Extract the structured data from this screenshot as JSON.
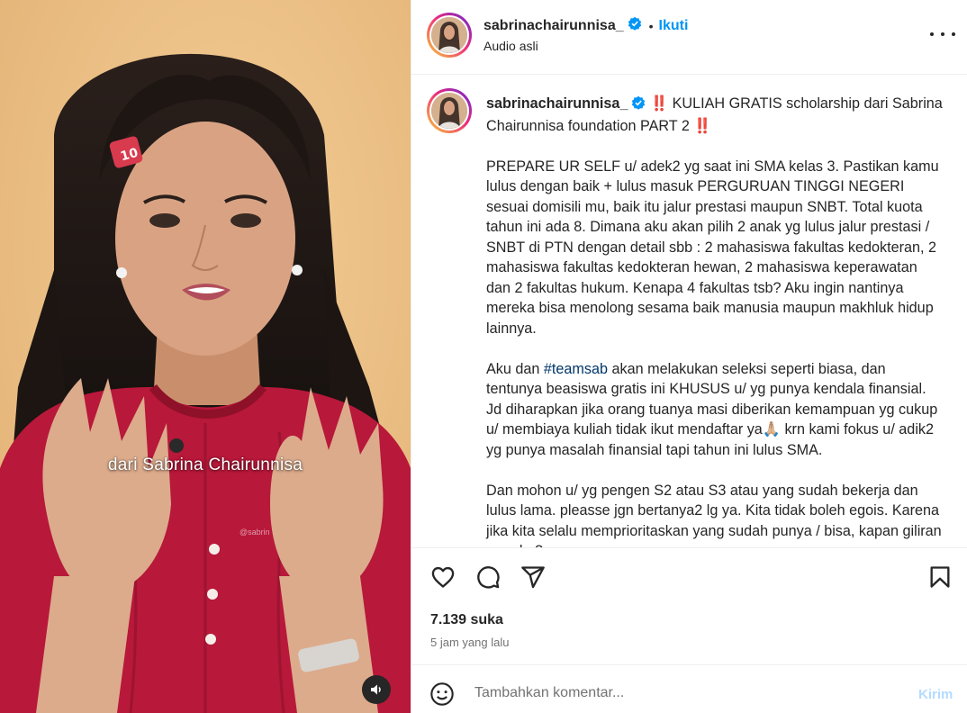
{
  "post": {
    "author": "sabrinachairunnisa_",
    "follow_label": "Ikuti",
    "separator": "•",
    "audio": "Audio asli"
  },
  "video": {
    "subtitle": "dari Sabrina Chairunnisa",
    "watermark": "@sabrin",
    "muted": true
  },
  "caption": {
    "author": "sabrinachairunnisa_",
    "bang_open": "‼️",
    "headline": "KULIAH GRATIS scholarship dari Sabrina Chairunnisa foundation PART 2",
    "bang_close": "‼️",
    "paragraph1": "PREPARE UR SELF u/ adek2 yg saat ini SMA kelas 3. Pastikan kamu lulus dengan baik + lulus masuk PERGURUAN TINGGI NEGERI sesuai domisili mu, baik itu jalur prestasi maupun SNBT. Total kuota tahun ini ada 8. Dimana aku akan pilih 2 anak yg lulus jalur prestasi / SNBT di PTN dengan detail sbb : 2 mahasiswa fakultas kedokteran, 2 mahasiswa fakultas kedokteran hewan, 2 mahasiswa keperawatan dan 2 fakultas hukum. Kenapa 4 fakultas tsb? Aku ingin nantinya mereka bisa menolong sesama baik manusia maupun makhluk hidup lainnya.",
    "paragraph2_before": "Aku dan ",
    "paragraph2_hashtag": "#teamsab",
    "paragraph2_after": " akan melakukan seleksi seperti biasa, dan tentunya beasiswa gratis ini KHUSUS u/ yg punya kendala finansial. Jd diharapkan jika orang tuanya masi diberikan kemampuan yg cukup u/ membiaya kuliah tidak ikut mendaftar ya🙏🏼 krn kami fokus u/ adik2 yg punya masalah finansial tapi tahun ini lulus SMA.",
    "paragraph3": "Dan mohon u/ yg pengen S2 atau S3 atau yang sudah bekerja dan lulus lama. pleasse jgn bertanya2 lg ya. Kita tidak boleh egois. Karena jika kita selalu memprioritaskan yang sudah punya / bisa, kapan giliran mereka?"
  },
  "engagement": {
    "likes": "7.139 suka",
    "time_ago": "5 jam yang lalu"
  },
  "composer": {
    "placeholder": "Tambahkan komentar...",
    "send_label": "Kirim"
  },
  "colors": {
    "accent": "#0095f6",
    "send_disabled": "#b3dbff",
    "verified": "#0095f6",
    "sweater": "#b8183a",
    "background": "#e9bd83"
  },
  "icons": [
    "heart-icon",
    "comment-icon",
    "share-icon",
    "bookmark-icon",
    "emoji-icon",
    "more-icon",
    "verified-icon",
    "speaker-muted-icon"
  ]
}
